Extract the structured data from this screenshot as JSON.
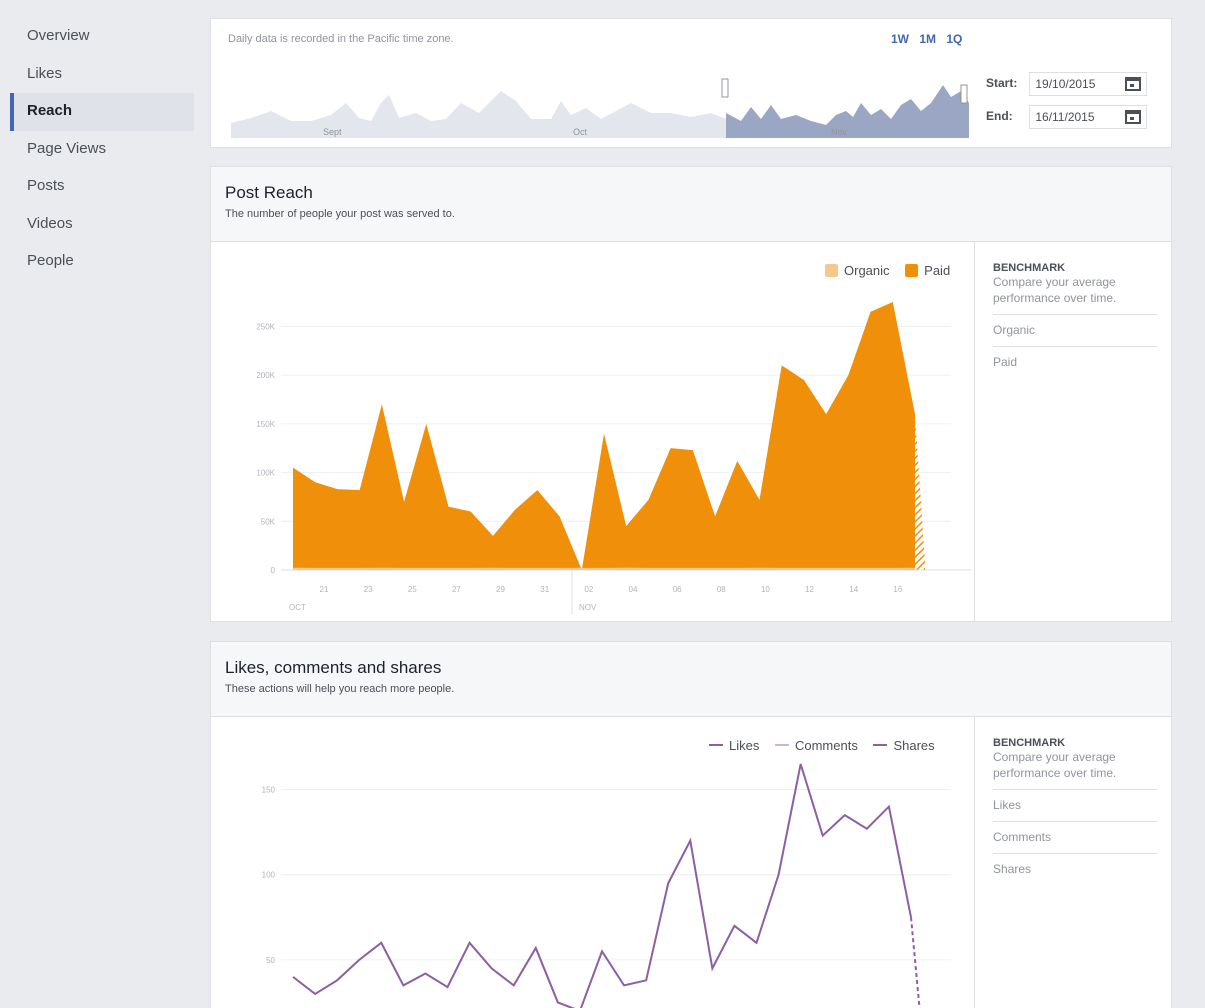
{
  "sidebar": {
    "items": [
      {
        "label": "Overview",
        "active": false
      },
      {
        "label": "Likes",
        "active": false
      },
      {
        "label": "Reach",
        "active": true
      },
      {
        "label": "Page Views",
        "active": false
      },
      {
        "label": "Posts",
        "active": false
      },
      {
        "label": "Videos",
        "active": false
      },
      {
        "label": "People",
        "active": false
      }
    ]
  },
  "timeline": {
    "note": "Daily data is recorded in the Pacific time zone.",
    "ranges": [
      "1W",
      "1M",
      "1Q"
    ],
    "months": [
      "Sept",
      "Oct",
      "Nov"
    ],
    "start_label": "Start:",
    "start_value": "19/10/2015",
    "end_label": "End:",
    "end_value": "16/11/2015"
  },
  "post_reach": {
    "title": "Post Reach",
    "subtitle": "The number of people your post was served to.",
    "legend": {
      "organic": "Organic",
      "paid": "Paid"
    },
    "benchmark": {
      "title": "BENCHMARK",
      "desc": "Compare your average performance over time.",
      "items": [
        "Organic",
        "Paid"
      ]
    }
  },
  "engagement": {
    "title": "Likes, comments and shares",
    "subtitle": "These actions will help you reach more people.",
    "legend": {
      "likes": "Likes",
      "comments": "Comments",
      "shares": "Shares"
    },
    "benchmark": {
      "title": "BENCHMARK",
      "desc": "Compare your average performance over time.",
      "items": [
        "Likes",
        "Comments",
        "Shares"
      ]
    }
  },
  "colors": {
    "accent": "#4267b2",
    "paid": "#f0900a",
    "organic": "#f5c98a",
    "likes": "#8c5fa2",
    "comments": "#c9b7d4",
    "timeline_selected": "#9aa6c3",
    "timeline_unselected": "#e3e6ec"
  },
  "chart_data": [
    {
      "type": "area",
      "x_labels": [
        "21",
        "23",
        "25",
        "27",
        "29",
        "31",
        "02",
        "04",
        "06",
        "08",
        "10",
        "12",
        "14",
        "16"
      ],
      "month_labels": [
        "OCT",
        "NOV"
      ],
      "y_ticks": [
        "0",
        "50K",
        "100K",
        "150K",
        "200K",
        "250K"
      ],
      "ylim": [
        0,
        275000
      ],
      "series": [
        {
          "name": "Organic",
          "values": [
            500,
            400,
            400,
            400,
            500,
            400,
            400,
            400,
            400,
            500,
            400,
            400,
            400,
            400,
            400,
            500,
            400,
            400,
            400,
            400,
            400,
            500,
            400,
            400,
            400,
            400,
            400,
            400,
            500
          ]
        },
        {
          "name": "Paid",
          "values": [
            105000,
            90000,
            83000,
            82000,
            170000,
            70000,
            150000,
            65000,
            60000,
            35000,
            62000,
            82000,
            55000,
            0,
            140000,
            45000,
            72000,
            125000,
            123000,
            55000,
            112000,
            72000,
            210000,
            195000,
            160000,
            200000,
            265000,
            275000,
            160000
          ]
        }
      ]
    },
    {
      "type": "line",
      "y_ticks": [
        "50",
        "100",
        "150"
      ],
      "ylim": [
        0,
        175
      ],
      "series": [
        {
          "name": "Likes",
          "values": [
            40,
            30,
            38,
            50,
            60,
            35,
            42,
            34,
            60,
            45,
            35,
            57,
            25,
            20,
            55,
            35,
            38,
            95,
            120,
            45,
            70,
            60,
            100,
            165,
            123,
            135,
            127,
            140,
            75,
            0
          ]
        }
      ]
    }
  ]
}
